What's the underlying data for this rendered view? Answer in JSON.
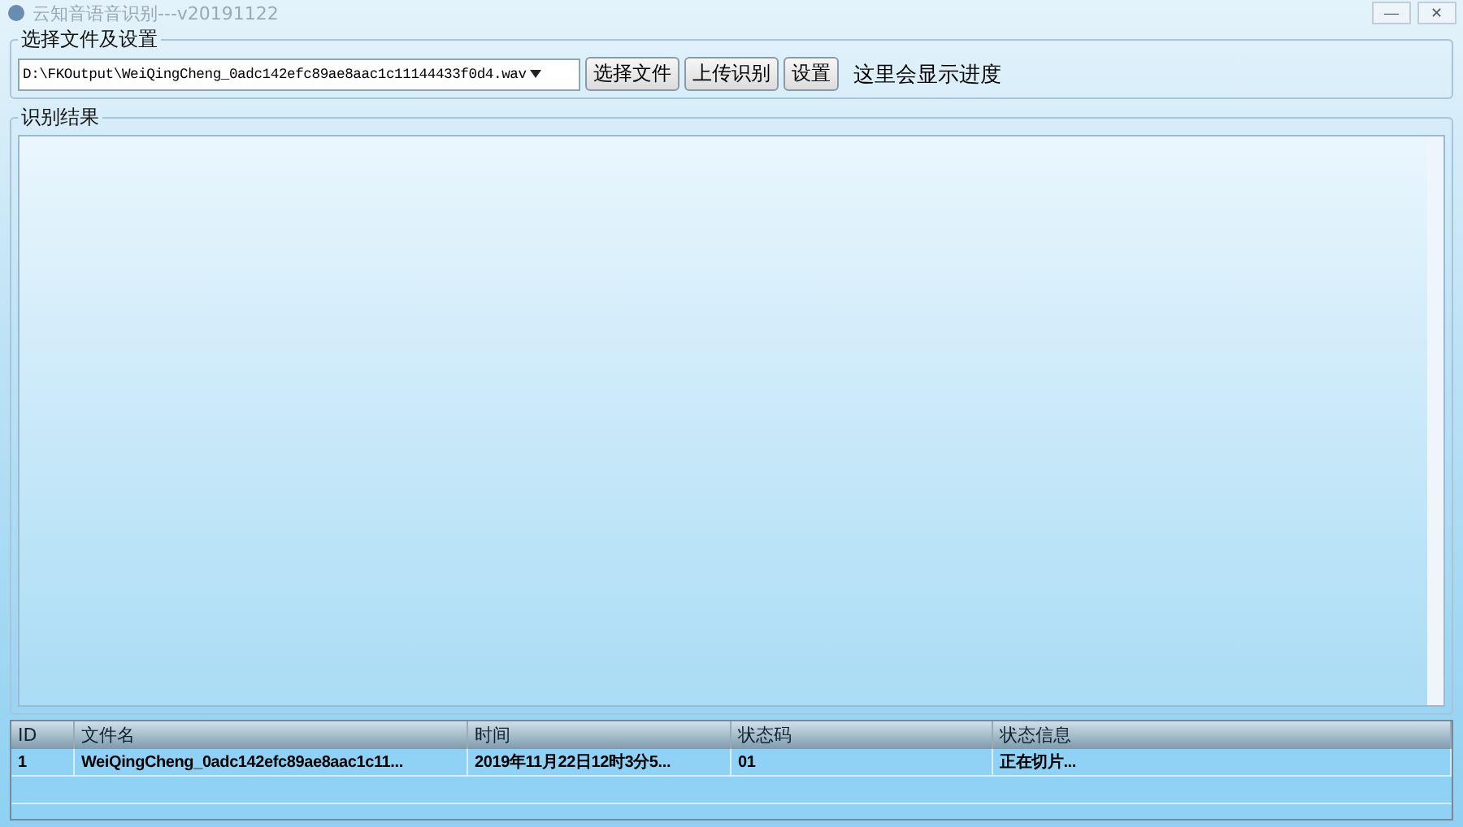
{
  "window": {
    "title": "云知音语音识别---v20191122",
    "buttons": [
      "—",
      "✕"
    ]
  },
  "file_group": {
    "title": "选择文件及设置",
    "file_path": "D:\\FKOutput\\WeiQingCheng_0adc142efc89ae8aac1c11144433f0d4.wav",
    "buttons": [
      "选择文件",
      "上传识别",
      "设置"
    ],
    "progress_text": "这里会显示进度"
  },
  "result_group": {
    "title": "识别结果"
  },
  "table": {
    "columns": [
      "ID",
      "文件名",
      "时间",
      "状态码",
      "状态信息"
    ],
    "rows": [
      {
        "cells": [
          "1",
          "WeiQingCheng_0adc142efc89ae8aac1c11...",
          "2019年11月22日12时3分5...",
          "01",
          "正在切片..."
        ]
      }
    ]
  }
}
